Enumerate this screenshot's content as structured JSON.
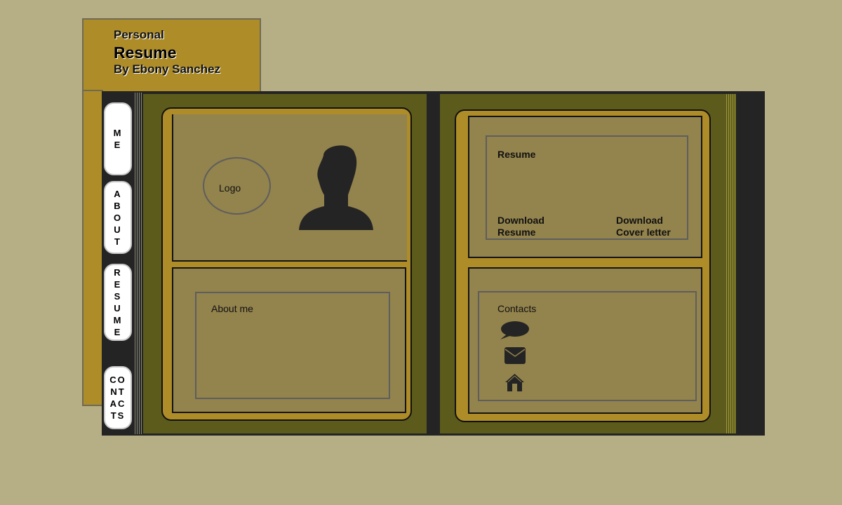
{
  "header": {
    "line1": "Personal",
    "line2": "Resume",
    "line3": "By Ebony Sanchez"
  },
  "tabs": [
    {
      "id": "me",
      "chars": [
        "M",
        "E"
      ]
    },
    {
      "id": "about",
      "chars": [
        "A",
        "B",
        "O",
        "U",
        "T"
      ]
    },
    {
      "id": "resume",
      "chars": [
        "R",
        "E",
        "S",
        "U",
        "M",
        "E"
      ]
    },
    {
      "id": "contacts",
      "chars": [
        "CO",
        "NT",
        "AC",
        "TS"
      ]
    }
  ],
  "left_page": {
    "logo_label": "Logo",
    "about_label": "About me"
  },
  "right_page": {
    "resume_label": "Resume",
    "download_resume": [
      "Download",
      "Resume"
    ],
    "download_cover": [
      "Download",
      "Cover letter"
    ],
    "contacts_label": "Contacts",
    "contact_icons": [
      "chat-bubble-icon",
      "envelope-icon",
      "home-icon"
    ]
  },
  "colors": {
    "background": "#b6af86",
    "gold": "#ae8c28",
    "page_olive": "#5c5b1c",
    "panel": "#93834d",
    "binder": "#242424"
  }
}
